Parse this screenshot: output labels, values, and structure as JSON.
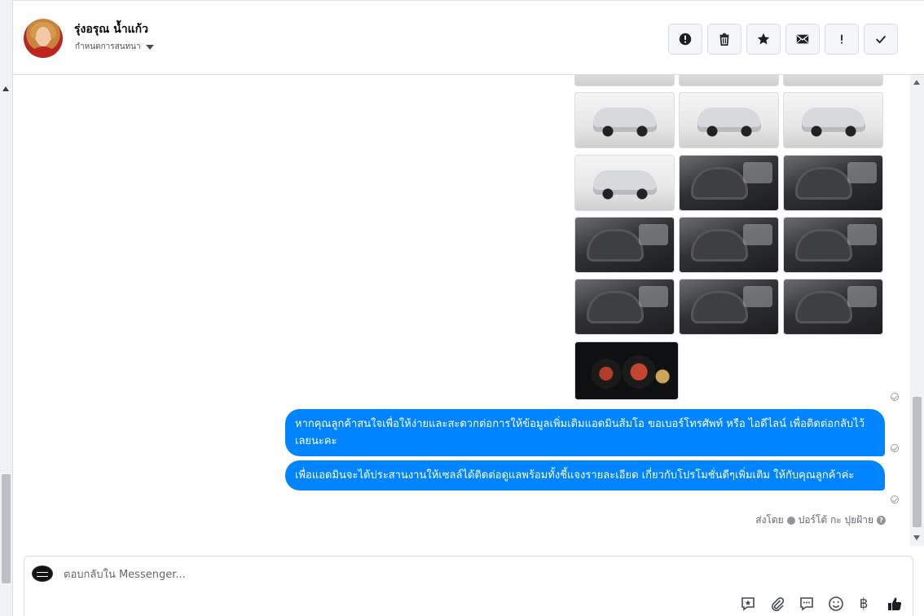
{
  "header": {
    "name": "รุ่งอรุณ น้ำแก้ว",
    "subtitle": "กำหนดการสนทนา",
    "tools": [
      {
        "id": "spam",
        "icon": "alert-circle-icon"
      },
      {
        "id": "delete",
        "icon": "trash-icon"
      },
      {
        "id": "star",
        "icon": "star-icon"
      },
      {
        "id": "mark-unread",
        "icon": "envelope-icon"
      },
      {
        "id": "important",
        "icon": "exclamation-icon"
      },
      {
        "id": "done",
        "icon": "check-icon"
      }
    ]
  },
  "messages": [
    {
      "text": "หากคุณลูกค้าสนใจเพื่อให้ง่ายและสะดวกต่อการให้ข้อมูลเพิ่มเติมแอดมินส้มโอ ขอเบอร์โทรศัพท์ หรือ ไอดีไลน์ เพื่อติดต่อกลับไว้เลยนะคะ"
    },
    {
      "text": "เพื่อแอดมินจะได้ประสานงานให้เซลล์ได้ติดต่อดูแลพร้อมทั้งชี้แจงรายละเอียด เกี่ยวกับโปรโมชั่นดีๆเพิ่มเติม ให้กับคุณลูกค้าค่ะ"
    }
  ],
  "sent_by": {
    "label": "ส่งโดย",
    "name": "ปอร์โต้ กะ ปุยฝ้าย",
    "help": "?"
  },
  "composer": {
    "placeholder": "ตอบกลับใน Messenger...",
    "icons": [
      "saved-reply-icon",
      "attachment-icon",
      "chat-bubble-icon",
      "emoji-icon",
      "baht-icon",
      "thumbs-up-icon"
    ],
    "baht_glyph": "฿"
  },
  "colors": {
    "bubble": "#0084ff",
    "bubble_text": "#ffffff",
    "border": "#dadde1"
  }
}
